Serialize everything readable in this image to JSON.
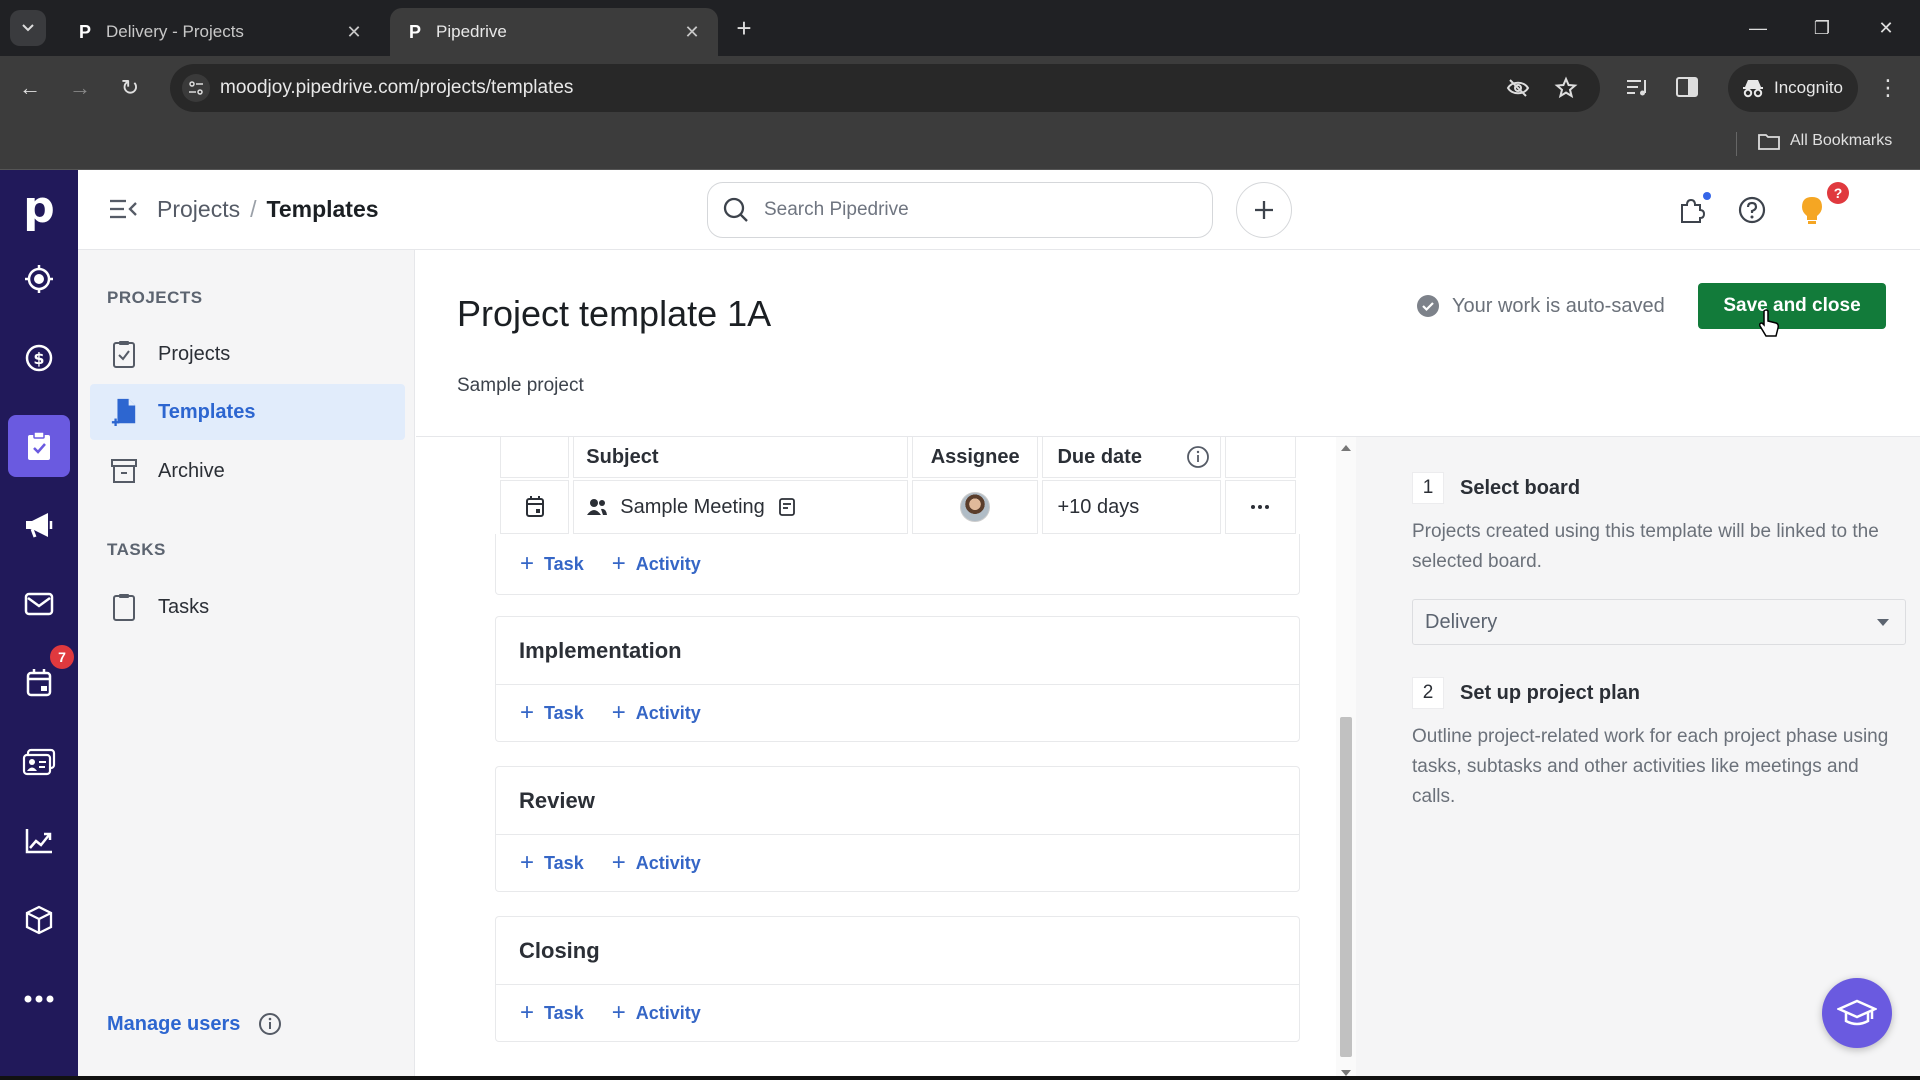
{
  "browser": {
    "tabs": [
      {
        "title": "Delivery - Projects",
        "favicon": "P",
        "active": false
      },
      {
        "title": "Pipedrive",
        "favicon": "P",
        "active": true
      }
    ],
    "url": "moodjoy.pipedrive.com/projects/templates",
    "incognito_label": "Incognito",
    "all_bookmarks_label": "All Bookmarks"
  },
  "rail": {
    "logo": "p",
    "items": [
      {
        "icon": "target-icon",
        "label": "Leads"
      },
      {
        "icon": "dollar-icon",
        "label": "Deals"
      },
      {
        "icon": "projects-clipboard-icon",
        "label": "Projects",
        "active": true
      },
      {
        "icon": "megaphone-icon",
        "label": "Campaigns"
      },
      {
        "icon": "mail-icon",
        "label": "Mail"
      },
      {
        "icon": "calendar-icon",
        "label": "Activities",
        "badge": "7"
      },
      {
        "icon": "contacts-icon",
        "label": "Contacts"
      },
      {
        "icon": "chart-icon",
        "label": "Insights"
      },
      {
        "icon": "box-icon",
        "label": "Products"
      },
      {
        "icon": "more-icon",
        "label": "More"
      }
    ]
  },
  "header": {
    "breadcrumb": {
      "parent": "Projects",
      "separator": "/",
      "current": "Templates"
    },
    "search_placeholder": "Search Pipedrive",
    "notification_badge": "?"
  },
  "sidebar": {
    "projects_section": "PROJECTS",
    "items": [
      {
        "label": "Projects",
        "icon": "clipboard-check-icon"
      },
      {
        "label": "Templates",
        "icon": "template-icon",
        "active": true
      },
      {
        "label": "Archive",
        "icon": "archive-icon"
      }
    ],
    "tasks_section": "TASKS",
    "task_items": [
      {
        "label": "Tasks",
        "icon": "clipboard-icon"
      }
    ],
    "manage_users": "Manage users"
  },
  "main": {
    "title": "Project template 1A",
    "subtitle": "Sample project",
    "autosave_text": "Your work is auto-saved",
    "save_button": "Save and close",
    "table": {
      "headers": {
        "subject": "Subject",
        "assignee": "Assignee",
        "due_date": "Due date"
      },
      "rows": [
        {
          "type_icon": "calendar-icon",
          "subject": "Sample Meeting",
          "subject_icon": "meeting-icon",
          "due": "+10 days"
        }
      ]
    },
    "add_task": "Task",
    "add_activity": "Activity",
    "phases": [
      {
        "title": "Implementation"
      },
      {
        "title": "Review"
      },
      {
        "title": "Closing"
      }
    ]
  },
  "right_panel": {
    "step1": {
      "number": "1",
      "title": "Select board",
      "description": "Projects created using this template will be linked to the selected board."
    },
    "board_value": "Delivery",
    "step2": {
      "number": "2",
      "title": "Set up project plan",
      "description": "Outline project-related work for each project phase using tasks, subtasks and other activities like meetings and calls."
    }
  }
}
